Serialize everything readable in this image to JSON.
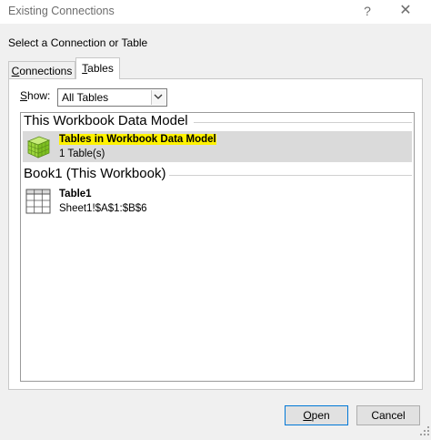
{
  "window": {
    "title": "Existing Connections",
    "help_glyph": "?",
    "close_glyph": "✕"
  },
  "prompt": "Select a Connection or Table",
  "tabs": [
    {
      "label": "Connections",
      "mnemonic": "C",
      "active": false
    },
    {
      "label": "Tables",
      "mnemonic": "T",
      "active": true
    }
  ],
  "show": {
    "label": "Show:",
    "mnemonic": "S",
    "selected": "All Tables"
  },
  "groups": [
    {
      "header": "This Workbook Data Model",
      "items": [
        {
          "title": "Tables in Workbook Data Model",
          "subtitle": "1 Table(s)",
          "icon": "data-model-cube-icon",
          "selected": true
        }
      ]
    },
    {
      "header": "Book1 (This Workbook)",
      "items": [
        {
          "title": "Table1",
          "subtitle": "Sheet1!$A$1:$B$6",
          "icon": "table-grid-icon",
          "selected": false
        }
      ]
    }
  ],
  "buttons": {
    "open": "Open",
    "open_mnemonic": "O",
    "cancel": "Cancel"
  },
  "colors": {
    "highlight": "#fff200",
    "selection": "#dadada",
    "cube_green": "#9bd43a"
  }
}
